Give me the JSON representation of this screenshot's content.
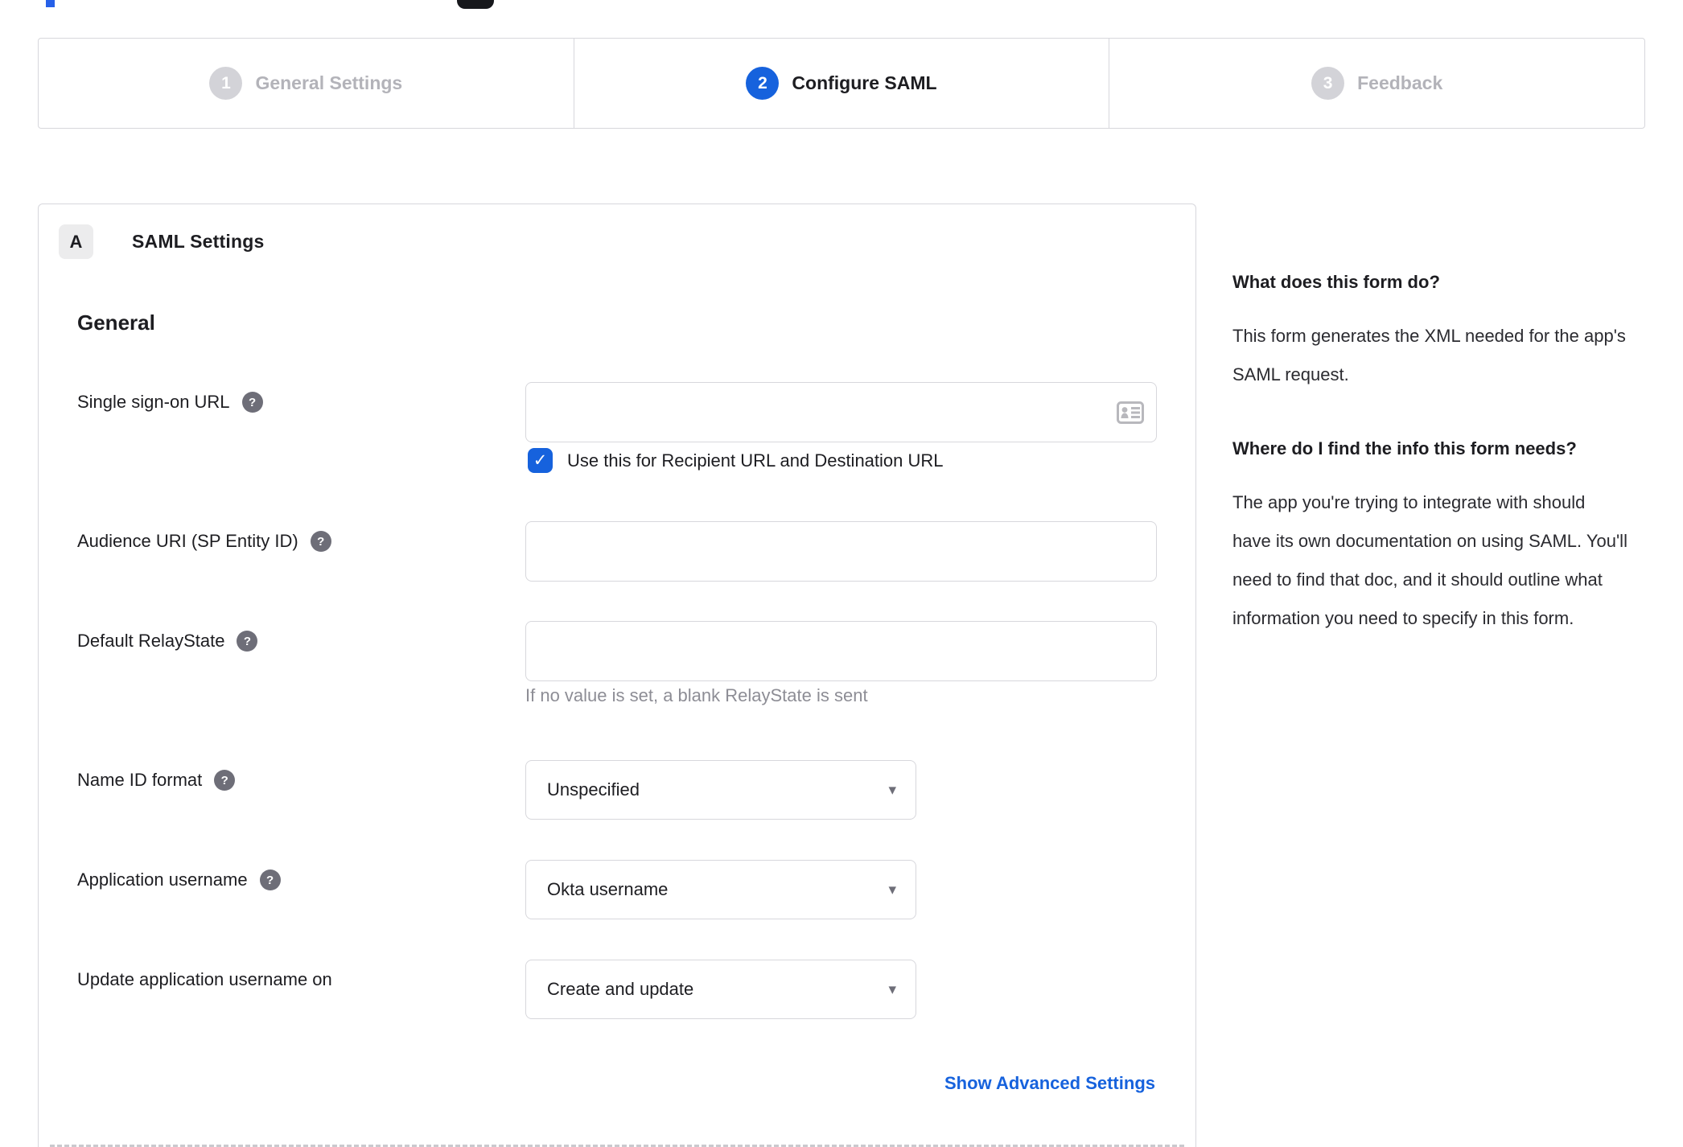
{
  "colors": {
    "accent": "#1662dd",
    "border": "#d7d7dc",
    "text": "#1d1d21",
    "muted": "#8d8d95",
    "inactive": "#b3b3b9"
  },
  "icons": {
    "help": "?",
    "caret": "▾",
    "check": "✓"
  },
  "stepper": {
    "steps": [
      {
        "number": "1",
        "label": "General Settings"
      },
      {
        "number": "2",
        "label": "Configure SAML"
      },
      {
        "number": "3",
        "label": "Feedback"
      }
    ]
  },
  "panel": {
    "section_badge": "A",
    "section_title": "SAML Settings",
    "group_heading": "General",
    "fields": {
      "sso": {
        "label": "Single sign-on URL",
        "value": "",
        "checkbox_label": "Use this for Recipient URL and Destination URL"
      },
      "audience": {
        "label": "Audience URI (SP Entity ID)",
        "value": ""
      },
      "relay": {
        "label": "Default RelayState",
        "value": "",
        "hint": "If no value is set, a blank RelayState is sent"
      },
      "nameid": {
        "label": "Name ID format",
        "value": "Unspecified"
      },
      "appuser": {
        "label": "Application username",
        "value": "Okta username"
      },
      "updateuser": {
        "label": "Update application username on",
        "value": "Create and update"
      }
    },
    "advanced_link": "Show Advanced Settings"
  },
  "sidebar": {
    "q1": "What does this form do?",
    "a1": "This form generates the XML needed for the app's SAML request.",
    "q2": "Where do I find the info this form needs?",
    "a2": "The app you're trying to integrate with should have its own documentation on using SAML. You'll need to find that doc, and it should outline what information you need to specify in this form."
  }
}
